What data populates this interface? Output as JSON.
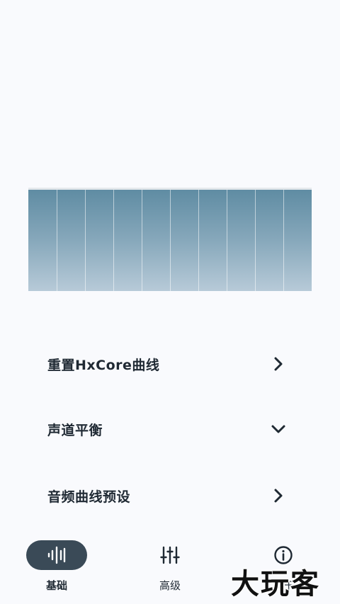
{
  "menu": {
    "reset": "重置HxCore曲线",
    "balance": "声道平衡",
    "presets": "音频曲线预设"
  },
  "nav": {
    "basic": "基础",
    "advanced": "高级",
    "about": "关于"
  },
  "watermark": "大玩客",
  "colors": {
    "eq_top": "#5f8ca3",
    "eq_bottom": "#b7cad8",
    "nav_active_pill": "#3a4a57"
  }
}
